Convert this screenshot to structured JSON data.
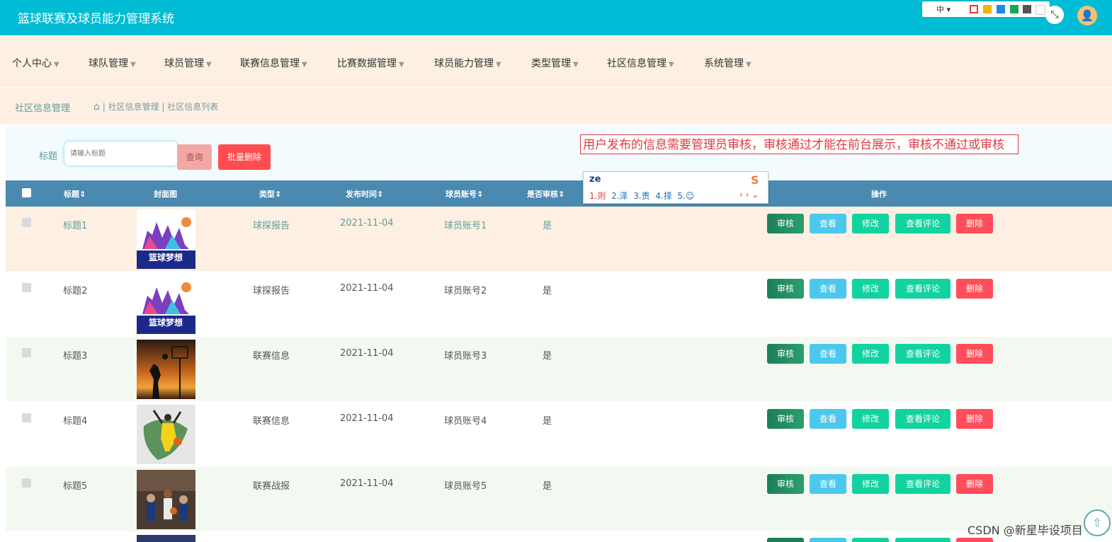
{
  "app": {
    "title": "篮球联赛及球员能力管理系统"
  },
  "ime_toolbar": {
    "lang": "中 ▾",
    "swatches": [
      "#e53935",
      "#f5b400",
      "#1e88e5",
      "#1aa64b",
      "#555555",
      "#ffffff"
    ]
  },
  "header": {
    "fullscreen_icon": "⤡",
    "avatar_icon": "👤"
  },
  "nav": {
    "items": [
      {
        "label": "个人中心"
      },
      {
        "label": "球队管理"
      },
      {
        "label": "球员管理"
      },
      {
        "label": "联赛信息管理"
      },
      {
        "label": "比赛数据管理"
      },
      {
        "label": "球员能力管理"
      },
      {
        "label": "类型管理"
      },
      {
        "label": "社区信息管理"
      },
      {
        "label": "系统管理"
      }
    ],
    "caret": "▼"
  },
  "breadcrumb": {
    "section": "社区信息管理",
    "home_icon": "⌂",
    "path": " | 社区信息管理 | 社区信息列表"
  },
  "search": {
    "label": "标题",
    "placeholder": "请输入标题",
    "query_button": "查询",
    "batch_delete_button": "批量删除"
  },
  "annotation": "用户发布的信息需要管理员审核，审核通过才能在前台展示，审核不通过或审核",
  "ime": {
    "input": "ze",
    "candidates": [
      "1.则",
      "2.泽",
      "3.责",
      "4.择",
      "5.☺"
    ],
    "logo": "S",
    "arrows": "‹ › ⌄"
  },
  "table": {
    "headers": {
      "title": "标题⇕",
      "cover": "封面图",
      "type": "类型⇕",
      "date": "发布时间⇕",
      "account": "球员账号⇕",
      "reviewed": "是否审核⇕",
      "actions": "操作"
    },
    "actions": {
      "review": "审核",
      "view": "查看",
      "edit": "修改",
      "comments": "查看评论",
      "delete": "删除"
    },
    "rows": [
      {
        "title": "标题1",
        "type": "球探报告",
        "date": "2021-11-04",
        "account": "球员账号1",
        "reviewed": "是",
        "cover": "poster"
      },
      {
        "title": "标题2",
        "type": "球探报告",
        "date": "2021-11-04",
        "account": "球员账号2",
        "reviewed": "是",
        "cover": "poster"
      },
      {
        "title": "标题3",
        "type": "联赛信息",
        "date": "2021-11-04",
        "account": "球员账号3",
        "reviewed": "是",
        "cover": "sunset"
      },
      {
        "title": "标题4",
        "type": "联赛信息",
        "date": "2021-11-04",
        "account": "球员账号4",
        "reviewed": "是",
        "cover": "dunk"
      },
      {
        "title": "标题5",
        "type": "联赛战报",
        "date": "2021-11-04",
        "account": "球员账号5",
        "reviewed": "是",
        "cover": "crowd"
      }
    ]
  },
  "colors": {
    "topbar": "#00bcd4",
    "table_header": "#4a8ab0",
    "row_alt_first": "#fdf0e2",
    "row_alt": "#f3f9f1"
  },
  "watermark": "CSDN @新星毕设项目",
  "backtop_icon": "⇧"
}
